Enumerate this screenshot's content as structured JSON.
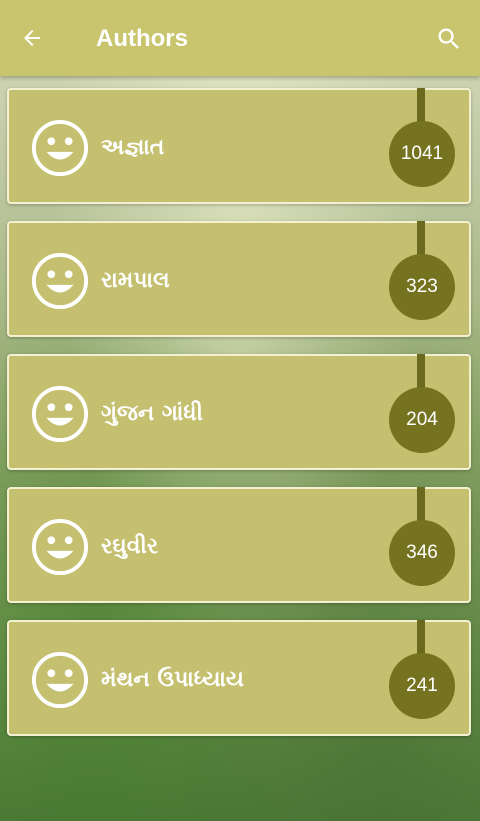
{
  "header": {
    "title": "Authors",
    "back_icon": "arrow-back-icon",
    "search_icon": "search-icon"
  },
  "authors": [
    {
      "name": "અજ્ઞાત",
      "count": "1041"
    },
    {
      "name": "રામપાલ",
      "count": "323"
    },
    {
      "name": "ગુંજન ગાંધી",
      "count": "204"
    },
    {
      "name": "રઘુવીર",
      "count": "346"
    },
    {
      "name": "મંથન ઉપાધ્યાય",
      "count": "241"
    }
  ],
  "colors": {
    "appbar": "#c9c46e",
    "card": "#c4c070",
    "badge": "#75731f",
    "text": "#ffffff"
  },
  "icons": {
    "avatar": "smiley-face-icon"
  }
}
